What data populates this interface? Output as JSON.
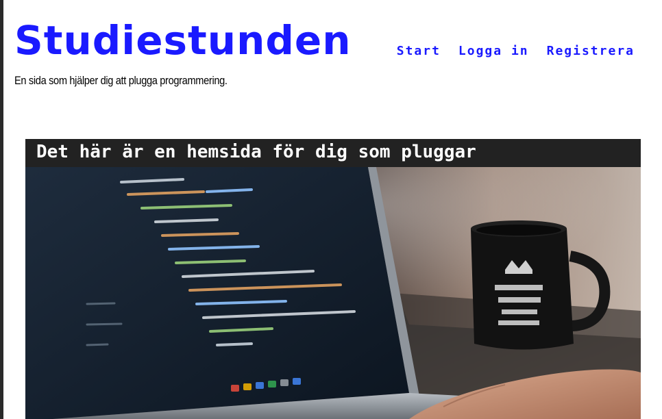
{
  "site": {
    "title": "Studiestunden",
    "tagline": "En sida som hjälper dig att plugga programmering."
  },
  "nav": {
    "items": [
      {
        "label": "Start"
      },
      {
        "label": "Logga in"
      },
      {
        "label": "Registrera"
      }
    ]
  },
  "hero": {
    "heading": "Det här är en hemsida för dig som pluggar"
  },
  "colors": {
    "brand": "#1a1aff",
    "banner": "#222222",
    "background": "#ffffff"
  }
}
